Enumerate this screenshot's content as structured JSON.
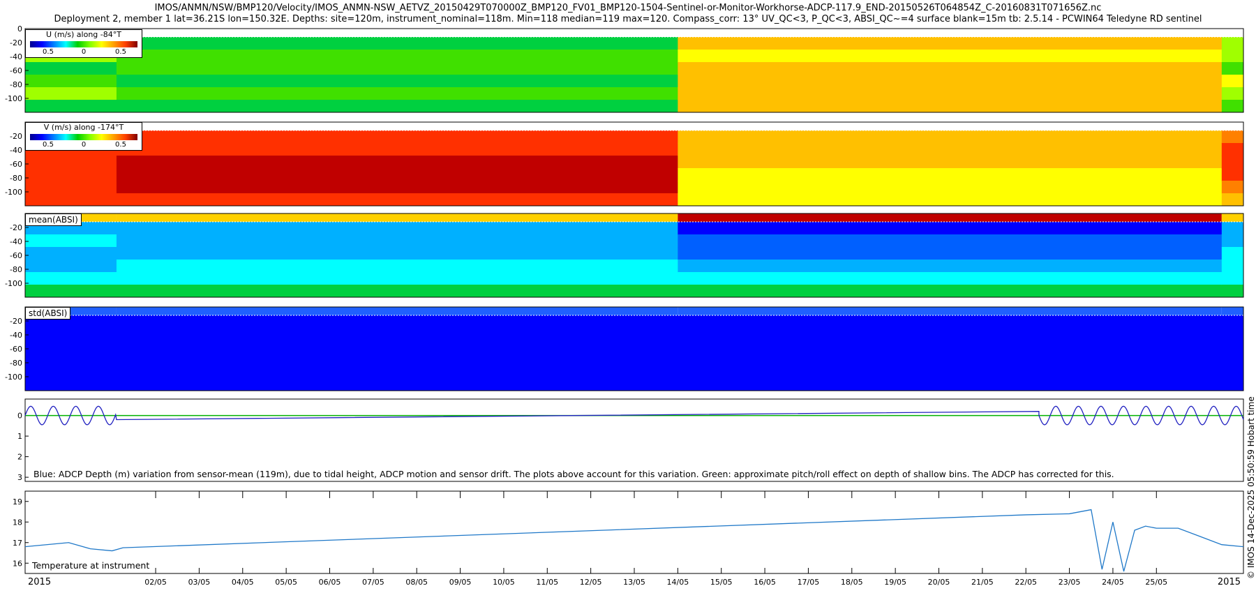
{
  "header": {
    "title_line1": "IMOS/ANMN/NSW/BMP120/Velocity/IMOS_ANMN-NSW_AETVZ_20150429T070000Z_BMP120_FV01_BMP120-1504-Sentinel-or-Monitor-Workhorse-ADCP-117.9_END-20150526T064854Z_C-20160831T071656Z.nc",
    "title_line2": "Deployment 2, member 1 lat=36.21S lon=150.32E. Depths: site=120m, instrument_nominal=118m. Min=118 median=119 max=120. Compass_corr: 13° UV_QC<3, P_QC<3, ABSI_QC~=4 surface blank=15m tb: 2.5.14 - PCWIN64 Teledyne RD sentinel"
  },
  "credit": "© IMOS 14-Dec-2025 05:50:59 Hobart time",
  "colors": {
    "axis": "#000000",
    "depth_line": "#2020c0",
    "pitch_line": "#00b000",
    "temp_line": "#1f78c8"
  },
  "panels": {
    "u": {
      "label": "U (m/s) along -84°T",
      "ticks": [
        "0.5",
        "0",
        "0.5"
      ],
      "range": [
        -0.8,
        0.8
      ]
    },
    "v": {
      "label": "V (m/s) along -174°T",
      "ticks": [
        "0.5",
        "0",
        "0.5"
      ],
      "range": [
        -0.8,
        0.8
      ]
    },
    "mean_absi": {
      "label": "mean(ABSI)"
    },
    "std_absi": {
      "label": "std(ABSI)"
    },
    "depth_var": {
      "note": "Blue: ADCP Depth (m) variation from sensor-mean (119m), due to tidal height, ADCP motion and sensor drift. The plots above account for this variation. Green: approximate pitch/roll effect on depth of shallow bins. The ADCP has corrected for this."
    },
    "temp": {
      "label": "Temperature at instrument"
    }
  },
  "chart_data": [
    {
      "type": "heatmap",
      "name": "U",
      "ylabel": "",
      "yticks": [
        "0",
        "-20",
        "-40",
        "-60",
        "-80",
        "-100"
      ],
      "ylim": [
        -120,
        0
      ],
      "xlim": [
        "2015-04-29",
        "2015-05-27"
      ],
      "segments": [
        {
          "from": "2015-04-29",
          "to": "2015-05-01",
          "description_value": 0.05
        },
        {
          "from": "2015-05-01",
          "to": "2015-05-12",
          "value": 0.0
        },
        {
          "from": "2015-05-12",
          "to": "2015-05-23",
          "value": 0.25
        },
        {
          "from": "2015-05-23",
          "to": "2015-05-27",
          "value": 0.1
        }
      ]
    },
    {
      "type": "heatmap",
      "name": "V",
      "yticks": [
        "-20",
        "-40",
        "-60",
        "-80",
        "-100"
      ],
      "ylim": [
        -120,
        0
      ],
      "segments": [
        {
          "from": "2015-04-29",
          "to": "2015-05-01",
          "value": 0.55
        },
        {
          "from": "2015-05-01",
          "to": "2015-05-12",
          "value": 0.65
        },
        {
          "from": "2015-05-12",
          "to": "2015-05-23",
          "value": 0.35
        },
        {
          "from": "2015-05-23",
          "to": "2015-05-27",
          "value": 0.5
        }
      ]
    },
    {
      "type": "heatmap",
      "name": "mean(ABSI)",
      "yticks": [
        "-20",
        "-40",
        "-60",
        "-80",
        "-100"
      ],
      "ylim": [
        -120,
        0
      ]
    },
    {
      "type": "heatmap",
      "name": "std(ABSI)",
      "yticks": [
        "-20",
        "-40",
        "-60",
        "-80",
        "-100"
      ],
      "ylim": [
        -120,
        0
      ]
    },
    {
      "type": "line",
      "name": "depth_variation",
      "yticks": [
        "0",
        "1",
        "2",
        "3"
      ],
      "ylim": [
        -0.8,
        3.2
      ],
      "x": [
        "2015-04-29",
        "2015-04-29T12",
        "2015-04-30",
        "2015-04-30T12",
        "2015-05-01",
        "2015-05-01T06",
        "2015-05-12",
        "2015-05-22",
        "2015-05-22T12",
        "2015-05-23",
        "2015-05-23T12",
        "2015-05-24",
        "2015-05-24T12",
        "2015-05-25",
        "2015-05-25T12",
        "2015-05-26",
        "2015-05-26T12",
        "2015-05-27"
      ],
      "y": [
        -0.5,
        0.4,
        -0.5,
        0.4,
        -0.6,
        0.2,
        0.0,
        -0.2,
        0.2,
        0.6,
        -0.4,
        0.5,
        -0.4,
        0.5,
        -0.4,
        0.4,
        -0.3,
        0.2
      ],
      "pitch_roll_y": 0.0
    },
    {
      "type": "line",
      "name": "temperature",
      "yticks": [
        "16",
        "17",
        "18",
        "19"
      ],
      "ylim": [
        15.5,
        19.5
      ],
      "x": [
        "2015-04-29",
        "2015-04-30",
        "2015-04-30T12",
        "2015-05-01",
        "2015-05-01T06",
        "2015-05-22",
        "2015-05-23",
        "2015-05-23T12",
        "2015-05-23T18",
        "2015-05-24",
        "2015-05-24T06",
        "2015-05-24T12",
        "2015-05-24T18",
        "2015-05-25",
        "2015-05-25T12",
        "2015-05-26",
        "2015-05-26T12",
        "2015-05-27"
      ],
      "y": [
        16.8,
        17.0,
        16.7,
        16.6,
        16.75,
        18.35,
        18.4,
        18.6,
        15.7,
        18.0,
        15.6,
        17.6,
        17.8,
        17.7,
        17.7,
        17.3,
        16.9,
        16.8
      ]
    }
  ],
  "xaxis": {
    "ticks": [
      "2015",
      "02/05",
      "03/05",
      "04/05",
      "05/05",
      "06/05",
      "07/05",
      "08/05",
      "09/05",
      "10/05",
      "11/05",
      "12/05",
      "13/05",
      "14/05",
      "15/05",
      "16/05",
      "17/05",
      "18/05",
      "19/05",
      "20/05",
      "21/05",
      "22/05",
      "23/05",
      "24/05",
      "25/05",
      "2015"
    ]
  }
}
